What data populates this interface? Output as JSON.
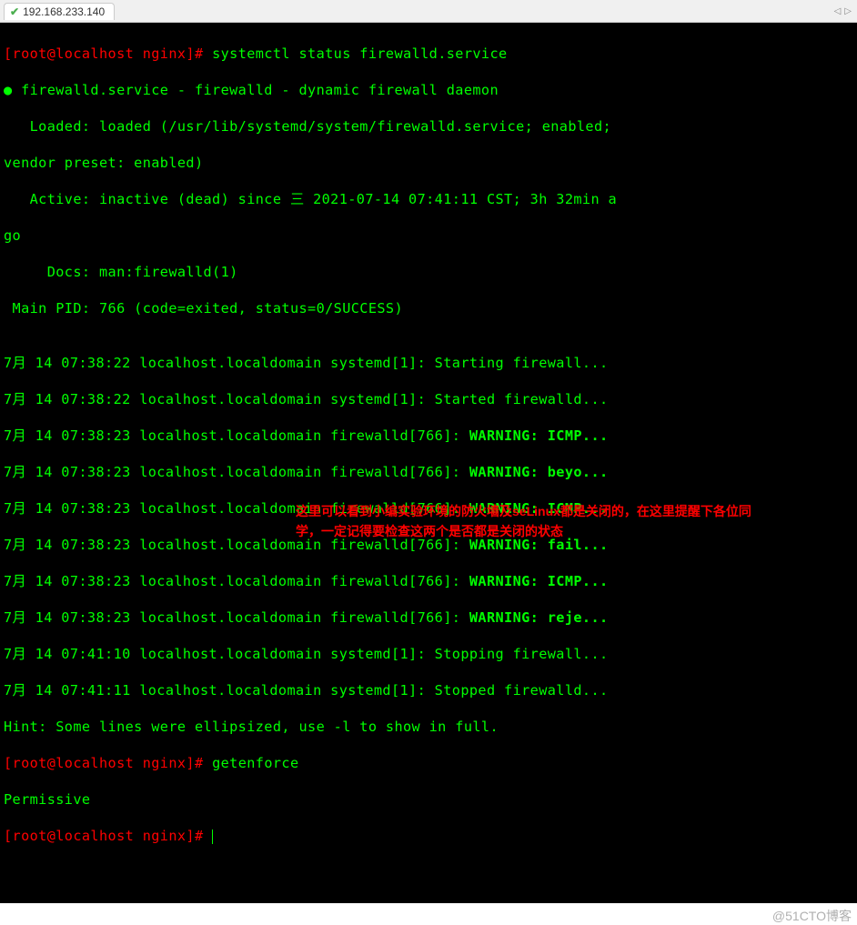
{
  "tab": {
    "label": "192.168.233.140"
  },
  "scroll_hints": {
    "left": "◁",
    "right": "▷"
  },
  "prompt": {
    "user_host": "[root@localhost nginx]",
    "symbol": "#"
  },
  "commands": {
    "cmd1": "systemctl status firewalld.service",
    "cmd2": "getenforce"
  },
  "output": {
    "unit_line": "● firewalld.service - firewalld - dynamic firewall daemon",
    "loaded": "   Loaded: loaded (/usr/lib/systemd/system/firewalld.service; enabled;",
    "vendor": "vendor preset: enabled)",
    "active": "   Active: inactive (dead) since 三 2021-07-14 07:41:11 CST; 3h 32min a",
    "active2": "go",
    "docs": "     Docs: man:firewalld(1)",
    "mainpid": " Main PID: 766 (code=exited, status=0/SUCCESS)",
    "blank": "",
    "log1a": "7月 14 07:38:22 localhost.localdomain systemd[1]: Starting firewall...",
    "log2a": "7月 14 07:38:22 localhost.localdomain systemd[1]: Started firewalld...",
    "log3p": "7月 14 07:38:23 localhost.localdomain firewalld[766]: ",
    "log3b": "WARNING: ICMP...",
    "log4p": "7月 14 07:38:23 localhost.localdomain firewalld[766]: ",
    "log4b": "WARNING: beyo...",
    "log5p": "7月 14 07:38:23 localhost.localdomain firewalld[766]: ",
    "log5b": "WARNING: ICMP...",
    "log6p": "7月 14 07:38:23 localhost.localdomain firewalld[766]: ",
    "log6b": "WARNING: fail...",
    "log7p": "7月 14 07:38:23 localhost.localdomain firewalld[766]: ",
    "log7b": "WARNING: ICMP...",
    "log8p": "7月 14 07:38:23 localhost.localdomain firewalld[766]: ",
    "log8b": "WARNING: reje...",
    "log9": "7月 14 07:41:10 localhost.localdomain systemd[1]: Stopping firewall...",
    "log10": "7月 14 07:41:11 localhost.localdomain systemd[1]: Stopped firewalld...",
    "hint": "Hint: Some lines were ellipsized, use -l to show in full.",
    "permissive": "Permissive"
  },
  "note": {
    "line1": "这里可以看到小编实验环境的防火墙及seLinux都是关闭的，在这里提醒下各位同",
    "line2": "学，一定记得要检查这两个是否都是关闭的状态"
  },
  "watermark": "@51CTO博客"
}
